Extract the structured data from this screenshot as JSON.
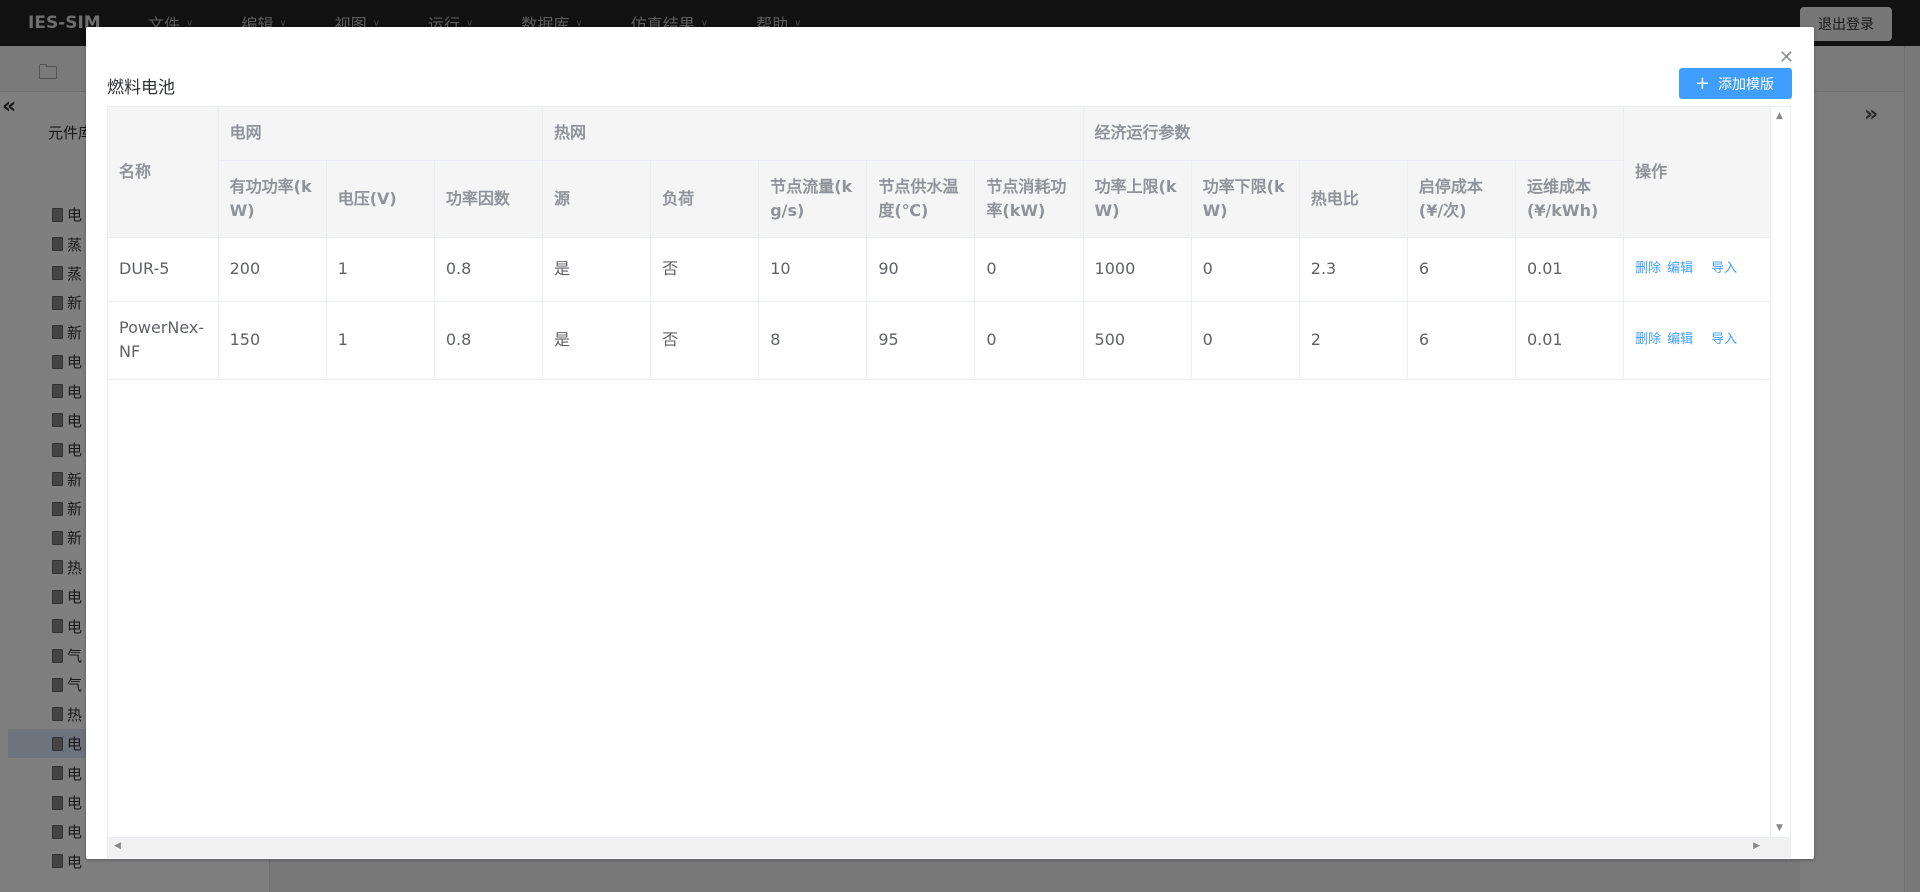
{
  "app": {
    "logo": "IES-SIM",
    "menu": [
      "文件",
      "编辑",
      "视图",
      "运行",
      "数据库",
      "仿真结果",
      "帮助"
    ],
    "logout": "退出登录",
    "sidebar_title": "元件库",
    "tree": [
      "电",
      "蒸",
      "蒸",
      "新",
      "新",
      "电",
      "电",
      "电",
      "电",
      "新",
      "新",
      "新",
      "热",
      "电",
      "电",
      "气",
      "气",
      "热",
      "电",
      "电",
      "电",
      "电",
      "电"
    ]
  },
  "dialog": {
    "title": "燃料电池",
    "add_button": "添加模版",
    "table": {
      "group_headers": {
        "name": "名称",
        "grid": "电网",
        "heat": "热网",
        "econ": "经济运行参数",
        "ops": "操作"
      },
      "columns": [
        "有功功率(kW)",
        "电压(V)",
        "功率因数",
        "源",
        "负荷",
        "节点流量(kg/s)",
        "节点供水温度(℃)",
        "节点消耗功率(kW)",
        "功率上限(kW)",
        "功率下限(kW)",
        "热电比",
        "启停成本(¥/次)",
        "运维成本(¥/kWh)"
      ],
      "rows": [
        {
          "name": "DUR-5",
          "values": [
            "200",
            "1",
            "0.8",
            "是",
            "否",
            "10",
            "90",
            "0",
            "1000",
            "0",
            "2.3",
            "6",
            "0.01"
          ]
        },
        {
          "name": "PowerNex-NF",
          "values": [
            "150",
            "1",
            "0.8",
            "是",
            "否",
            "8",
            "95",
            "0",
            "500",
            "0",
            "2",
            "6",
            "0.01"
          ]
        }
      ],
      "actions": {
        "delete": "删除",
        "edit": "编辑",
        "import": "导入"
      }
    }
  }
}
